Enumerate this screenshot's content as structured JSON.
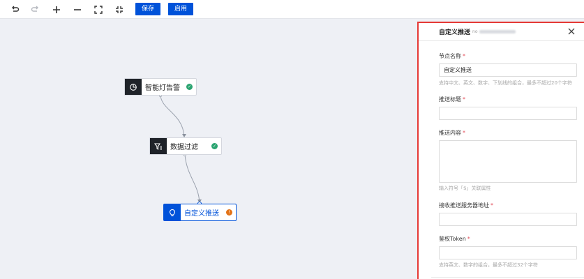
{
  "toolbar": {
    "save_label": "保存",
    "enable_label": "启用"
  },
  "nodes": [
    {
      "label": "智能灯告警",
      "status": "success"
    },
    {
      "label": "数据过滤",
      "status": "success"
    },
    {
      "label": "自定义推送",
      "status": "warning"
    }
  ],
  "colors": {
    "primary": "#0052d9",
    "success": "#2ba471",
    "warning": "#e37318",
    "highlight_border": "#e53935"
  },
  "panel": {
    "title": "自定义推送",
    "subtitle_prefix": "no",
    "fields": [
      {
        "label": "节点名称",
        "value": "自定义推送",
        "help": "支持中文、英文、数字、下划线的组合，最多不超过20个字符"
      },
      {
        "label": "推送标题",
        "value": ""
      },
      {
        "label": "推送内容",
        "help": "输入符号「$」关联属性"
      },
      {
        "label": "接收推送服务器地址",
        "value": ""
      },
      {
        "label": "鉴权Token",
        "value": "",
        "help": "支持英文、数字的组合，最多不超过32个字符"
      }
    ],
    "required_mark": "*"
  }
}
